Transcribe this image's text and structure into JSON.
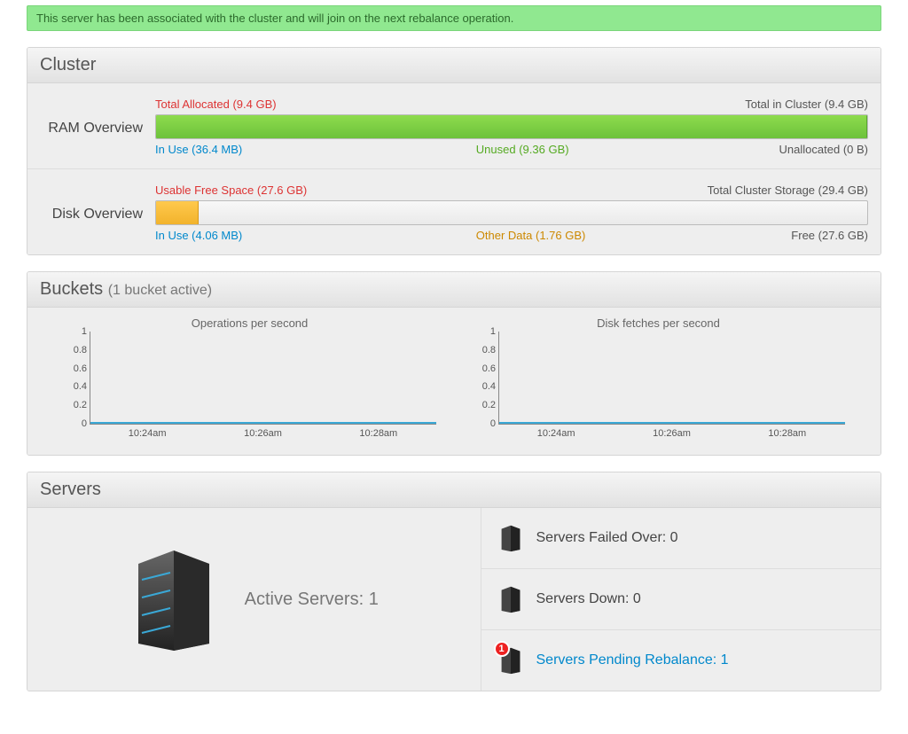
{
  "alert": "This server has been associated with the cluster and will join on the next rebalance operation.",
  "cluster": {
    "title": "Cluster",
    "ram": {
      "label": "RAM Overview",
      "topLeft": "Total Allocated (9.4 GB)",
      "topRight": "Total in Cluster (9.4 GB)",
      "inUse": "In Use (36.4 MB)",
      "unused": "Unused (9.36 GB)",
      "unallocated": "Unallocated (0 B)",
      "fillPercent": 100
    },
    "disk": {
      "label": "Disk Overview",
      "topLeft": "Usable Free Space (27.6 GB)",
      "topRight": "Total Cluster Storage (29.4 GB)",
      "inUse": "In Use (4.06 MB)",
      "other": "Other Data (1.76 GB)",
      "free": "Free (27.6 GB)",
      "fillPercent": 6
    }
  },
  "buckets": {
    "title": "Buckets",
    "sub": "(1 bucket active)",
    "charts": [
      {
        "title": "Operations per second"
      },
      {
        "title": "Disk fetches per second"
      }
    ],
    "yTicks": [
      "1",
      "0.8",
      "0.6",
      "0.4",
      "0.2",
      "0"
    ],
    "xTicks": [
      "10:24am",
      "10:26am",
      "10:28am"
    ]
  },
  "chart_data": [
    {
      "type": "line",
      "title": "Operations per second",
      "x": [
        "10:24am",
        "10:26am",
        "10:28am"
      ],
      "series": [
        {
          "name": "ops/sec",
          "values": [
            0,
            0,
            0
          ]
        }
      ],
      "ylim": [
        0,
        1
      ]
    },
    {
      "type": "line",
      "title": "Disk fetches per second",
      "x": [
        "10:24am",
        "10:26am",
        "10:28am"
      ],
      "series": [
        {
          "name": "fetches/sec",
          "values": [
            0,
            0,
            0
          ]
        }
      ],
      "ylim": [
        0,
        1
      ]
    }
  ],
  "servers": {
    "title": "Servers",
    "active": "Active Servers: 1",
    "rows": {
      "failed": "Servers Failed Over: 0",
      "down": "Servers Down: 0",
      "pending": "Servers Pending Rebalance: 1"
    },
    "pendingBadge": "1"
  }
}
